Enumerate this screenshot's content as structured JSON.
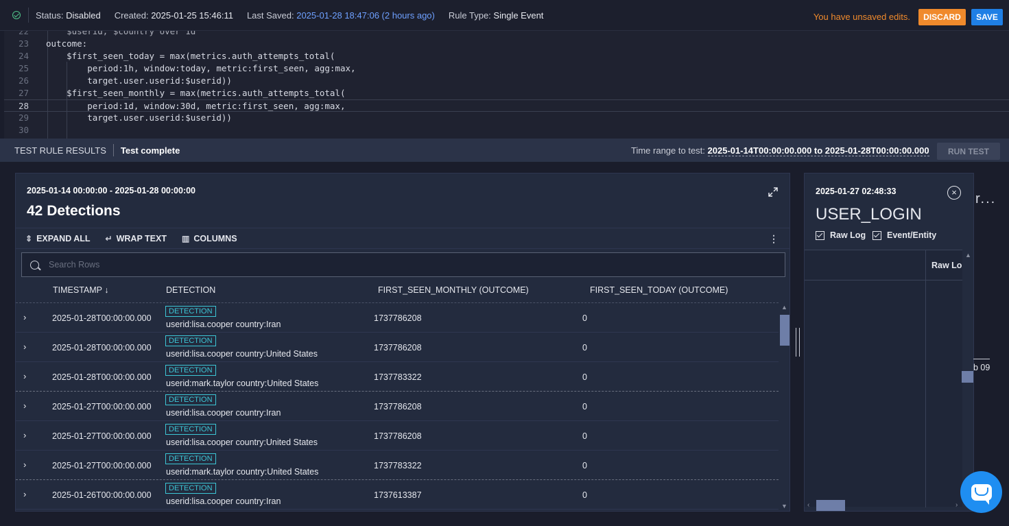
{
  "topbar": {
    "status_label": "Status:",
    "status_value": "Disabled",
    "created_label": "Created:",
    "created_value": "2025-01-25 15:46:11",
    "saved_label": "Last Saved:",
    "saved_value": "2025-01-28 18:47:06 (2 hours ago)",
    "ruletype_label": "Rule Type:",
    "ruletype_value": "Single Event",
    "unsaved": "You have unsaved edits.",
    "discard": "DISCARD",
    "save": "SAVE"
  },
  "editor": {
    "lines": [
      {
        "num": "22",
        "text": "    $userid, $country over 1d"
      },
      {
        "num": "23",
        "text": "outcome:"
      },
      {
        "num": "24",
        "text": "    $first_seen_today = max(metrics.auth_attempts_total("
      },
      {
        "num": "25",
        "text": "        period:1h, window:today, metric:first_seen, agg:max,"
      },
      {
        "num": "26",
        "text": "        target.user.userid:$userid))"
      },
      {
        "num": "27",
        "text": "    $first_seen_monthly = max(metrics.auth_attempts_total("
      },
      {
        "num": "28",
        "text": "        period:1d, window:30d, metric:first_seen, agg:max,"
      },
      {
        "num": "29",
        "text": "        target.user.userid:$userid))"
      },
      {
        "num": "30",
        "text": ""
      }
    ]
  },
  "results_bar": {
    "title": "TEST RULE RESULTS",
    "status": "Test complete",
    "time_label": "Time range to test:",
    "time_value": "2025-01-14T00:00:00.000 to 2025-01-28T00:00:00.000",
    "run_test": "RUN TEST"
  },
  "detections": {
    "range": "2025-01-14 00:00:00 - 2025-01-28 00:00:00",
    "count": "42 Detections",
    "toolbar": {
      "expand_all": "EXPAND ALL",
      "wrap_text": "WRAP TEXT",
      "columns": "COLUMNS"
    },
    "search_placeholder": "Search Rows",
    "columns": [
      "TIMESTAMP ↓",
      "DETECTION",
      "FIRST_SEEN_MONTHLY (OUTCOME)",
      "FIRST_SEEN_TODAY (OUTCOME)"
    ],
    "rows": [
      {
        "timestamp": "2025-01-28T00:00:00.000",
        "badge": "DETECTION",
        "detection": "userid:lisa.cooper country:Iran",
        "monthly": "1737786208",
        "today": "0"
      },
      {
        "timestamp": "2025-01-28T00:00:00.000",
        "badge": "DETECTION",
        "detection": "userid:lisa.cooper country:United States",
        "monthly": "1737786208",
        "today": "0"
      },
      {
        "timestamp": "2025-01-28T00:00:00.000",
        "badge": "DETECTION",
        "detection": "userid:mark.taylor country:United States",
        "monthly": "1737783322",
        "today": "0"
      },
      {
        "timestamp": "2025-01-27T00:00:00.000",
        "badge": "DETECTION",
        "detection": "userid:lisa.cooper country:Iran",
        "monthly": "1737786208",
        "today": "0"
      },
      {
        "timestamp": "2025-01-27T00:00:00.000",
        "badge": "DETECTION",
        "detection": "userid:lisa.cooper country:United States",
        "monthly": "1737786208",
        "today": "0"
      },
      {
        "timestamp": "2025-01-27T00:00:00.000",
        "badge": "DETECTION",
        "detection": "userid:mark.taylor country:United States",
        "monthly": "1737783322",
        "today": "0"
      },
      {
        "timestamp": "2025-01-26T00:00:00.000",
        "badge": "DETECTION",
        "detection": "userid:lisa.cooper country:Iran",
        "monthly": "1737613387",
        "today": "0"
      }
    ]
  },
  "side_panel": {
    "date": "2025-01-27 02:48:33",
    "event": "USER_LOGIN",
    "raw_log": "Raw Log",
    "event_entity": "Event/Entity",
    "column_header": "Raw Lo"
  },
  "background": {
    "faded_text": "r...",
    "tick_label": "b 09"
  }
}
